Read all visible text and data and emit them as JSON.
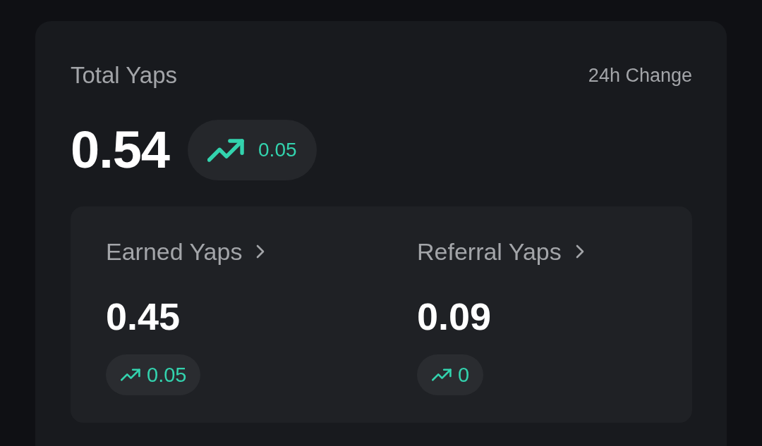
{
  "total": {
    "label": "Total Yaps",
    "change_label": "24h Change",
    "value": "0.54",
    "change": "0.05"
  },
  "breakdown": [
    {
      "label": "Earned Yaps",
      "value": "0.45",
      "change": "0.05"
    },
    {
      "label": "Referral Yaps",
      "value": "0.09",
      "change": "0"
    }
  ]
}
